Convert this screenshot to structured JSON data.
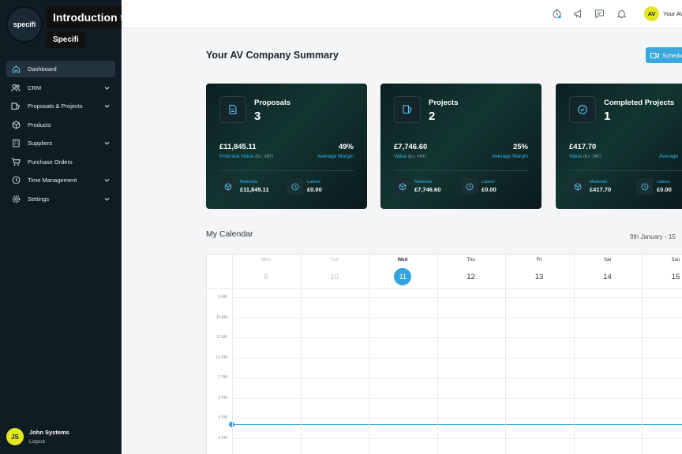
{
  "video": {
    "title": "Introduction to Specifi Video",
    "channel": "Specifi"
  },
  "logo": {
    "text": "specifi"
  },
  "sidebar": {
    "items": [
      {
        "label": "Dashboard",
        "icon": "home-icon",
        "active": true,
        "chevron": false
      },
      {
        "label": "CRM",
        "icon": "users-icon",
        "chevron": true
      },
      {
        "label": "Proposals & Projects",
        "icon": "folders-icon",
        "chevron": true
      },
      {
        "label": "Products",
        "icon": "box-icon",
        "chevron": false
      },
      {
        "label": "Suppliers",
        "icon": "building-icon",
        "chevron": true
      },
      {
        "label": "Purchase Orders",
        "icon": "cart-icon",
        "chevron": false
      },
      {
        "label": "Time Management",
        "icon": "clock-icon",
        "chevron": true
      },
      {
        "label": "Settings",
        "icon": "gear-icon",
        "chevron": true
      }
    ],
    "user": {
      "initials": "JS",
      "name": "John Systems",
      "logout": "Logout"
    }
  },
  "topbar": {
    "avatar_initials": "AV",
    "user_label": "Your AV"
  },
  "main": {
    "title": "Your AV Company Summary",
    "schedule_button": "Schedu",
    "cards": [
      {
        "title": "Proposals",
        "count": "3",
        "value": "£11,845.11",
        "value_label": "Potential Value",
        "value_note": "(Ex. VAT)",
        "percent": "49%",
        "percent_label": "Average Margin",
        "materials_label": "Materials",
        "materials": "£11,845.11",
        "labour_label": "Labour",
        "labour": "£0.00"
      },
      {
        "title": "Projects",
        "count": "2",
        "value": "£7,746.60",
        "value_label": "Value",
        "value_note": "(Ex. VAT)",
        "percent": "25%",
        "percent_label": "Average Margin",
        "materials_label": "Materials",
        "materials": "£7,746.60",
        "labour_label": "Labour",
        "labour": "£0.00"
      },
      {
        "title": "Completed Projects",
        "count": "1",
        "value": "£417.70",
        "value_label": "Value",
        "value_note": "(Ex. VAT)",
        "percent": "",
        "percent_label": "Average",
        "materials_label": "Materials",
        "materials": "£417.70",
        "labour_label": "Labour",
        "labour": "£0.00"
      }
    ]
  },
  "calendar": {
    "title": "My Calendar",
    "range": "9th January - 15",
    "days": [
      {
        "name": "Mon",
        "num": "9",
        "past": true
      },
      {
        "name": "Tue",
        "num": "10",
        "past": true
      },
      {
        "name": "Wed",
        "num": "11",
        "today": true
      },
      {
        "name": "Thu",
        "num": "12"
      },
      {
        "name": "Fri",
        "num": "13"
      },
      {
        "name": "Sat",
        "num": "14"
      },
      {
        "name": "Sun",
        "num": "15"
      }
    ],
    "hours": [
      "9 AM",
      "10 AM",
      "11 AM",
      "12 PM",
      "1 PM",
      "2 PM",
      "3 PM",
      "4 PM"
    ],
    "accent_color": "#31a4dd"
  }
}
